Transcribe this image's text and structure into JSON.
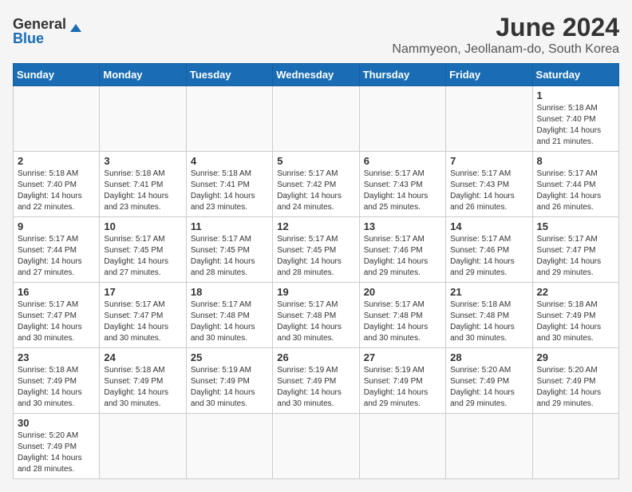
{
  "logo": {
    "general": "General",
    "blue": "Blue"
  },
  "header": {
    "month": "June 2024",
    "location": "Nammyeon, Jeollanam-do, South Korea"
  },
  "weekdays": [
    "Sunday",
    "Monday",
    "Tuesday",
    "Wednesday",
    "Thursday",
    "Friday",
    "Saturday"
  ],
  "weeks": [
    [
      {
        "day": "",
        "info": ""
      },
      {
        "day": "",
        "info": ""
      },
      {
        "day": "",
        "info": ""
      },
      {
        "day": "",
        "info": ""
      },
      {
        "day": "",
        "info": ""
      },
      {
        "day": "",
        "info": ""
      },
      {
        "day": "1",
        "info": "Sunrise: 5:18 AM\nSunset: 7:40 PM\nDaylight: 14 hours\nand 21 minutes."
      }
    ],
    [
      {
        "day": "2",
        "info": "Sunrise: 5:18 AM\nSunset: 7:40 PM\nDaylight: 14 hours\nand 22 minutes."
      },
      {
        "day": "3",
        "info": "Sunrise: 5:18 AM\nSunset: 7:41 PM\nDaylight: 14 hours\nand 23 minutes."
      },
      {
        "day": "4",
        "info": "Sunrise: 5:18 AM\nSunset: 7:41 PM\nDaylight: 14 hours\nand 23 minutes."
      },
      {
        "day": "5",
        "info": "Sunrise: 5:17 AM\nSunset: 7:42 PM\nDaylight: 14 hours\nand 24 minutes."
      },
      {
        "day": "6",
        "info": "Sunrise: 5:17 AM\nSunset: 7:43 PM\nDaylight: 14 hours\nand 25 minutes."
      },
      {
        "day": "7",
        "info": "Sunrise: 5:17 AM\nSunset: 7:43 PM\nDaylight: 14 hours\nand 26 minutes."
      },
      {
        "day": "8",
        "info": "Sunrise: 5:17 AM\nSunset: 7:44 PM\nDaylight: 14 hours\nand 26 minutes."
      }
    ],
    [
      {
        "day": "9",
        "info": "Sunrise: 5:17 AM\nSunset: 7:44 PM\nDaylight: 14 hours\nand 27 minutes."
      },
      {
        "day": "10",
        "info": "Sunrise: 5:17 AM\nSunset: 7:45 PM\nDaylight: 14 hours\nand 27 minutes."
      },
      {
        "day": "11",
        "info": "Sunrise: 5:17 AM\nSunset: 7:45 PM\nDaylight: 14 hours\nand 28 minutes."
      },
      {
        "day": "12",
        "info": "Sunrise: 5:17 AM\nSunset: 7:45 PM\nDaylight: 14 hours\nand 28 minutes."
      },
      {
        "day": "13",
        "info": "Sunrise: 5:17 AM\nSunset: 7:46 PM\nDaylight: 14 hours\nand 29 minutes."
      },
      {
        "day": "14",
        "info": "Sunrise: 5:17 AM\nSunset: 7:46 PM\nDaylight: 14 hours\nand 29 minutes."
      },
      {
        "day": "15",
        "info": "Sunrise: 5:17 AM\nSunset: 7:47 PM\nDaylight: 14 hours\nand 29 minutes."
      }
    ],
    [
      {
        "day": "16",
        "info": "Sunrise: 5:17 AM\nSunset: 7:47 PM\nDaylight: 14 hours\nand 30 minutes."
      },
      {
        "day": "17",
        "info": "Sunrise: 5:17 AM\nSunset: 7:47 PM\nDaylight: 14 hours\nand 30 minutes."
      },
      {
        "day": "18",
        "info": "Sunrise: 5:17 AM\nSunset: 7:48 PM\nDaylight: 14 hours\nand 30 minutes."
      },
      {
        "day": "19",
        "info": "Sunrise: 5:17 AM\nSunset: 7:48 PM\nDaylight: 14 hours\nand 30 minutes."
      },
      {
        "day": "20",
        "info": "Sunrise: 5:17 AM\nSunset: 7:48 PM\nDaylight: 14 hours\nand 30 minutes."
      },
      {
        "day": "21",
        "info": "Sunrise: 5:18 AM\nSunset: 7:48 PM\nDaylight: 14 hours\nand 30 minutes."
      },
      {
        "day": "22",
        "info": "Sunrise: 5:18 AM\nSunset: 7:49 PM\nDaylight: 14 hours\nand 30 minutes."
      }
    ],
    [
      {
        "day": "23",
        "info": "Sunrise: 5:18 AM\nSunset: 7:49 PM\nDaylight: 14 hours\nand 30 minutes."
      },
      {
        "day": "24",
        "info": "Sunrise: 5:18 AM\nSunset: 7:49 PM\nDaylight: 14 hours\nand 30 minutes."
      },
      {
        "day": "25",
        "info": "Sunrise: 5:19 AM\nSunset: 7:49 PM\nDaylight: 14 hours\nand 30 minutes."
      },
      {
        "day": "26",
        "info": "Sunrise: 5:19 AM\nSunset: 7:49 PM\nDaylight: 14 hours\nand 30 minutes."
      },
      {
        "day": "27",
        "info": "Sunrise: 5:19 AM\nSunset: 7:49 PM\nDaylight: 14 hours\nand 29 minutes."
      },
      {
        "day": "28",
        "info": "Sunrise: 5:20 AM\nSunset: 7:49 PM\nDaylight: 14 hours\nand 29 minutes."
      },
      {
        "day": "29",
        "info": "Sunrise: 5:20 AM\nSunset: 7:49 PM\nDaylight: 14 hours\nand 29 minutes."
      }
    ],
    [
      {
        "day": "30",
        "info": "Sunrise: 5:20 AM\nSunset: 7:49 PM\nDaylight: 14 hours\nand 28 minutes."
      },
      {
        "day": "",
        "info": ""
      },
      {
        "day": "",
        "info": ""
      },
      {
        "day": "",
        "info": ""
      },
      {
        "day": "",
        "info": ""
      },
      {
        "day": "",
        "info": ""
      },
      {
        "day": "",
        "info": ""
      }
    ]
  ]
}
